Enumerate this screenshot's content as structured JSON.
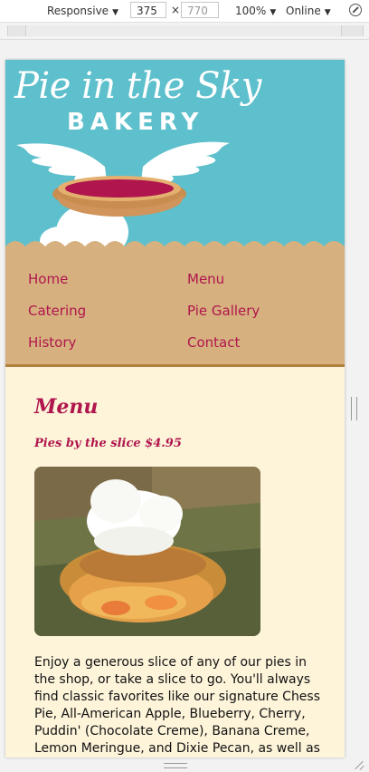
{
  "devtools": {
    "device_mode": "Responsive",
    "width_value": "375",
    "height_placeholder": "770",
    "zoom": "100%",
    "network": "Online",
    "separator": "×"
  },
  "site": {
    "brand_title": "Pie in the Sky",
    "brand_subtitle": "BAKERY",
    "nav": [
      {
        "label": "Home"
      },
      {
        "label": "Menu"
      },
      {
        "label": "Catering"
      },
      {
        "label": "Pie Gallery"
      },
      {
        "label": "History"
      },
      {
        "label": "Contact"
      }
    ],
    "page_title": "Menu",
    "section_title": "Pies by the slice $4.95",
    "body_text": "Enjoy a generous slice of any of our pies in the shop, or take a slice to go. You'll always find classic favorites like our signature Chess Pie, All-American Apple, Blueberry, Cherry, Puddin' (Chocolate Creme), Banana Creme, Lemon Meringue, and Dixie Pecan, as well as"
  },
  "colors": {
    "sky": "#5ec0cc",
    "crust": "#d6b17f",
    "accent": "#b0164d",
    "cream": "#fdf4da"
  }
}
